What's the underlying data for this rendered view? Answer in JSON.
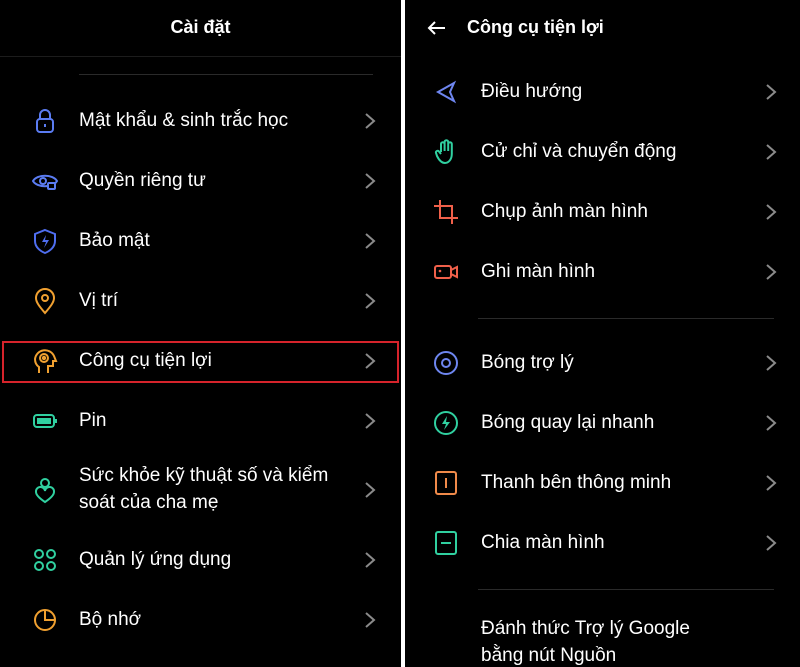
{
  "left": {
    "title": "Cài đặt",
    "items": [
      {
        "label": "Mật khẩu & sinh trắc học",
        "icon": "lock-icon",
        "color": "#5b7cf2"
      },
      {
        "label": "Quyền riêng tư",
        "icon": "eye-lock-icon",
        "color": "#5b7cf2"
      },
      {
        "label": "Bảo mật",
        "icon": "shield-bolt-icon",
        "color": "#4f6ef0"
      },
      {
        "label": "Vị trí",
        "icon": "location-pin-icon",
        "color": "#f0a030"
      },
      {
        "label": "Công cụ tiện lợi",
        "icon": "head-tools-icon",
        "color": "#f0a030"
      },
      {
        "label": "Pin",
        "icon": "battery-icon",
        "color": "#30d0a0"
      },
      {
        "label_line1": "Sức khỏe kỹ thuật số và kiểm",
        "label_line2": "soát của cha mẹ",
        "icon": "heart-person-icon",
        "color": "#30d0a0"
      },
      {
        "label": "Quản lý ứng dụng",
        "icon": "apps-grid-icon",
        "color": "#30d0a0"
      },
      {
        "label": "Bộ nhớ",
        "icon": "pie-chart-icon",
        "color": "#f0a030"
      }
    ]
  },
  "right": {
    "title": "Công cụ tiện lợi",
    "items": [
      {
        "label": "Điều hướng",
        "icon": "navigation-icon",
        "color": "#6e86f0"
      },
      {
        "label": "Cử chỉ và chuyển động",
        "icon": "hand-gesture-icon",
        "color": "#30d0a0"
      },
      {
        "label": "Chụp ảnh màn hình",
        "icon": "crop-icon",
        "color": "#f0604a"
      },
      {
        "label": "Ghi màn hình",
        "icon": "video-camera-icon",
        "color": "#f0604a"
      },
      {
        "label": "Bóng trợ lý",
        "icon": "assistant-ball-icon",
        "color": "#6e86f0"
      },
      {
        "label": "Bóng quay lại nhanh",
        "icon": "quick-return-bolt-icon",
        "color": "#30d0a0"
      },
      {
        "label": "Thanh bên thông minh",
        "icon": "smart-sidebar-icon",
        "color": "#f08a4a"
      },
      {
        "label": "Chia màn hình",
        "icon": "split-screen-icon",
        "color": "#30d0a0"
      },
      {
        "label_line1": "Đánh thức Trợ lý Google",
        "label_line2": "bằng nút Nguồn"
      }
    ]
  },
  "highlight_color": "#d6232b"
}
